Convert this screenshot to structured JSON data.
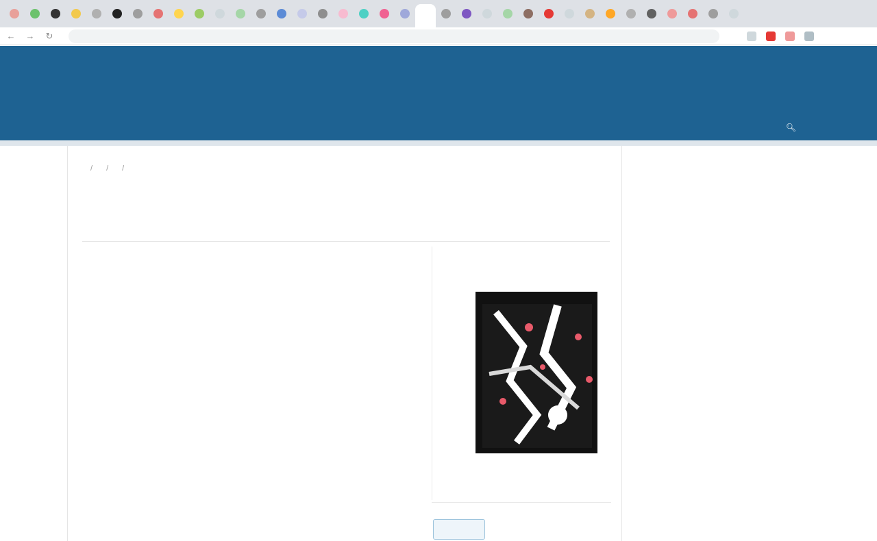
{
  "browser": {
    "tabs": [
      {
        "color": "#e8a09a"
      },
      {
        "color": "#6cc26c"
      },
      {
        "color": "#333333"
      },
      {
        "color": "#f2c94c"
      },
      {
        "color": "#b0b0b0"
      },
      {
        "color": "#222222"
      },
      {
        "color": "#9e9e9e"
      },
      {
        "color": "#e57373"
      },
      {
        "color": "#ffd54f"
      },
      {
        "color": "#9ccc65"
      },
      {
        "color": "#cfd8dc"
      },
      {
        "color": "#a5d6a7"
      },
      {
        "color": "#9e9e9e"
      },
      {
        "color": "#5c8bd6"
      },
      {
        "color": "#c5cae9"
      },
      {
        "color": "#8e8e8e"
      },
      {
        "color": "#f8bbd0"
      },
      {
        "color": "#4dd0c4"
      },
      {
        "color": "#f06292"
      },
      {
        "color": "#9fa8da"
      },
      {
        "color": "#ffffff"
      },
      {
        "color": "#9e9e9e"
      },
      {
        "color": "#7e57c2"
      },
      {
        "color": "#cfd8dc"
      },
      {
        "color": "#a5d6a7"
      },
      {
        "color": "#8d6e63"
      },
      {
        "color": "#e53935"
      },
      {
        "color": "#cfd8dc"
      },
      {
        "color": "#d4b483"
      },
      {
        "color": "#ffa726"
      },
      {
        "color": "#b0b0b0"
      },
      {
        "color": "#616161"
      },
      {
        "color": "#ef9a9a"
      },
      {
        "color": "#e57373"
      },
      {
        "color": "#9e9e9e"
      },
      {
        "color": "#cfd8dc"
      }
    ],
    "url": "",
    "accent": "#e53935"
  },
  "header": {
    "user_links": [
      "",
      ""
    ],
    "site_title": [
      "",
      ""
    ],
    "nav": [
      "",
      "",
      "",
      ""
    ],
    "search_label": "",
    "bg_color": "#1e6292"
  },
  "breadcrumb": [
    "",
    "",
    "",
    ""
  ],
  "article": {
    "title": "",
    "author": "",
    "affiliation": "",
    "label": "",
    "keywords_label": "",
    "keywords": ""
  },
  "issue": {
    "cover_title": "",
    "cover_caption": "",
    "cover_meta_left": "",
    "cover_meta_right": "",
    "pdf_label": ""
  },
  "sidebar": {
    "submit_link": "",
    "info_title": "",
    "info_links": [
      "",
      "",
      "",
      "",
      ""
    ],
    "language_title": "",
    "language_links": [
      "",
      "",
      ""
    ]
  }
}
